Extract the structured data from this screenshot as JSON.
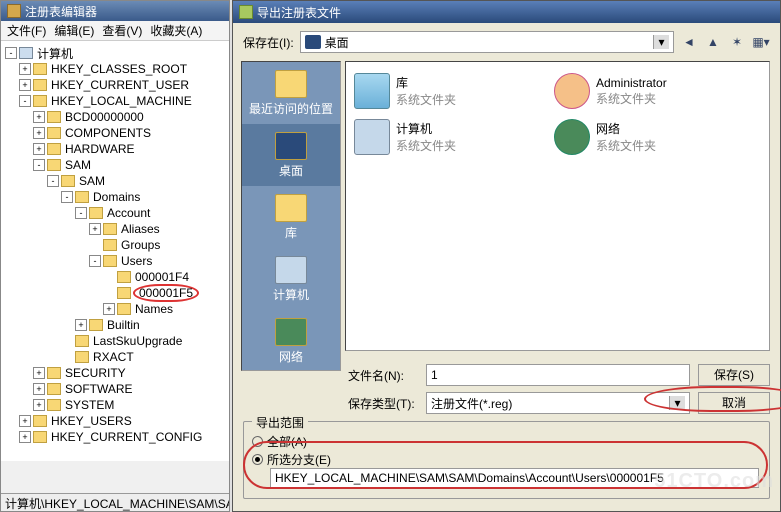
{
  "regedit": {
    "title": "注册表编辑器",
    "menu": {
      "file": "文件(F)",
      "edit": "编辑(E)",
      "view": "查看(V)",
      "fav": "收藏夹(A)"
    },
    "tree": {
      "root": "计算机",
      "n": [
        "HKEY_CLASSES_ROOT",
        "HKEY_CURRENT_USER",
        "HKEY_LOCAL_MACHINE",
        "BCD00000000",
        "COMPONENTS",
        "HARDWARE",
        "SAM",
        "SAM",
        "Domains",
        "Account",
        "Aliases",
        "Groups",
        "Users",
        "000001F4",
        "000001F5",
        "Names",
        "Builtin",
        "LastSkuUpgrade",
        "RXACT",
        "SECURITY",
        "SOFTWARE",
        "SYSTEM",
        "HKEY_USERS",
        "HKEY_CURRENT_CONFIG"
      ]
    },
    "status": "计算机\\HKEY_LOCAL_MACHINE\\SAM\\SAM\\Doma"
  },
  "dialog": {
    "title": "导出注册表文件",
    "saveInLabel": "保存在(I):",
    "saveInValue": "桌面",
    "places": [
      "最近访问的位置",
      "桌面",
      "库",
      "计算机",
      "网络"
    ],
    "items": [
      {
        "name": "库",
        "sub": "系统文件夹",
        "k": "lib"
      },
      {
        "name": "Administrator",
        "sub": "系统文件夹",
        "k": "usr"
      },
      {
        "name": "计算机",
        "sub": "系统文件夹",
        "k": "comp"
      },
      {
        "name": "网络",
        "sub": "系统文件夹",
        "k": "net"
      }
    ],
    "fileNameLabel": "文件名(N):",
    "fileNameValue": "1",
    "fileTypeLabel": "保存类型(T):",
    "fileTypeValue": "注册文件(*.reg)",
    "saveBtn": "保存(S)",
    "cancelBtn": "取消",
    "group": {
      "legend": "导出范围",
      "all": "全部(A)",
      "sel": "所选分支(E)",
      "path": "HKEY_LOCAL_MACHINE\\SAM\\SAM\\Domains\\Account\\Users\\000001F5"
    }
  },
  "watermark": "51CTO.com"
}
